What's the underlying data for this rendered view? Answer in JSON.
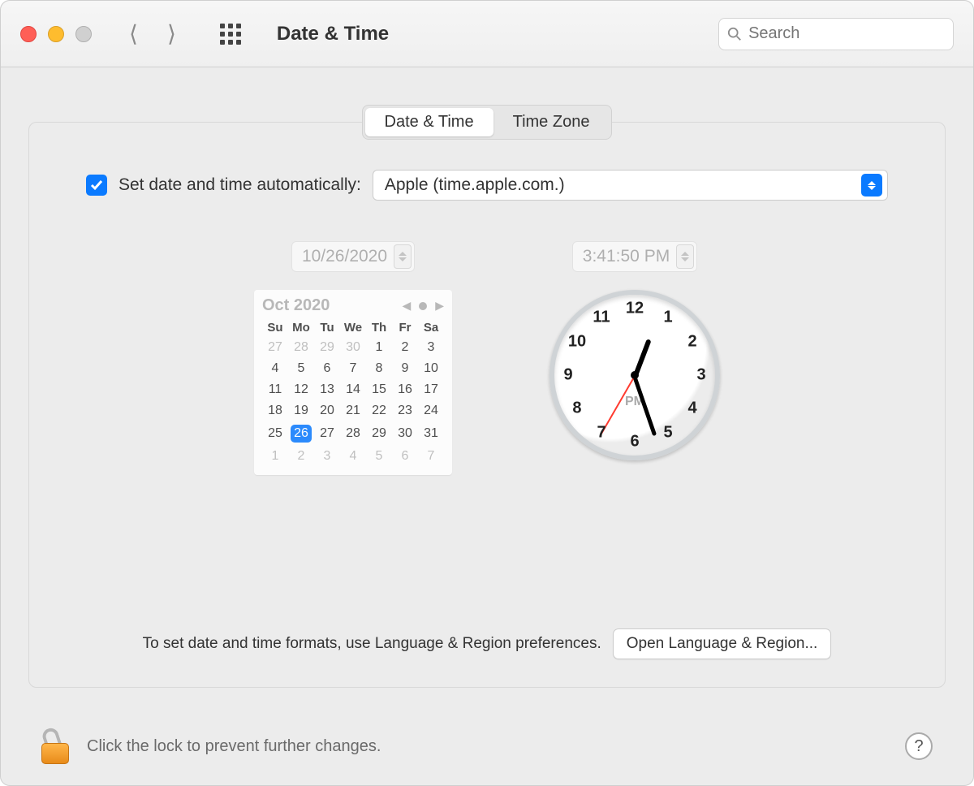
{
  "window": {
    "title": "Date & Time"
  },
  "search": {
    "placeholder": "Search"
  },
  "tabs": {
    "datetime": "Date & Time",
    "timezone": "Time Zone",
    "active": "datetime"
  },
  "auto": {
    "checked": true,
    "label": "Set date and time automatically:",
    "server": "Apple (time.apple.com.)"
  },
  "date_field": "10/26/2020",
  "time_field": "3:41:50 PM",
  "calendar": {
    "month_label": "Oct 2020",
    "weekdays": [
      "Su",
      "Mo",
      "Tu",
      "We",
      "Th",
      "Fr",
      "Sa"
    ],
    "rows": [
      [
        {
          "d": 27,
          "o": true
        },
        {
          "d": 28,
          "o": true
        },
        {
          "d": 29,
          "o": true
        },
        {
          "d": 30,
          "o": true
        },
        {
          "d": 1
        },
        {
          "d": 2
        },
        {
          "d": 3
        }
      ],
      [
        {
          "d": 4
        },
        {
          "d": 5
        },
        {
          "d": 6
        },
        {
          "d": 7
        },
        {
          "d": 8
        },
        {
          "d": 9
        },
        {
          "d": 10
        }
      ],
      [
        {
          "d": 11
        },
        {
          "d": 12
        },
        {
          "d": 13
        },
        {
          "d": 14
        },
        {
          "d": 15
        },
        {
          "d": 16
        },
        {
          "d": 17
        }
      ],
      [
        {
          "d": 18
        },
        {
          "d": 19
        },
        {
          "d": 20
        },
        {
          "d": 21
        },
        {
          "d": 22
        },
        {
          "d": 23
        },
        {
          "d": 24
        }
      ],
      [
        {
          "d": 25
        },
        {
          "d": 26,
          "sel": true
        },
        {
          "d": 27
        },
        {
          "d": 28
        },
        {
          "d": 29
        },
        {
          "d": 30
        },
        {
          "d": 31
        }
      ],
      [
        {
          "d": 1,
          "o": true
        },
        {
          "d": 2,
          "o": true
        },
        {
          "d": 3,
          "o": true
        },
        {
          "d": 4,
          "o": true
        },
        {
          "d": 5,
          "o": true
        },
        {
          "d": 6,
          "o": true
        },
        {
          "d": 7,
          "o": true
        }
      ]
    ]
  },
  "clock": {
    "ampm": "PM",
    "hour_hand_deg": 20.9,
    "minute_hand_deg": 161.0,
    "second_hand_deg": 210.0,
    "numbers": [
      "12",
      "1",
      "2",
      "3",
      "4",
      "5",
      "6",
      "7",
      "8",
      "9",
      "10",
      "11"
    ]
  },
  "formats": {
    "text": "To set date and time formats, use Language & Region preferences.",
    "button": "Open Language & Region..."
  },
  "footer": {
    "lock_text": "Click the lock to prevent further changes.",
    "help": "?"
  }
}
